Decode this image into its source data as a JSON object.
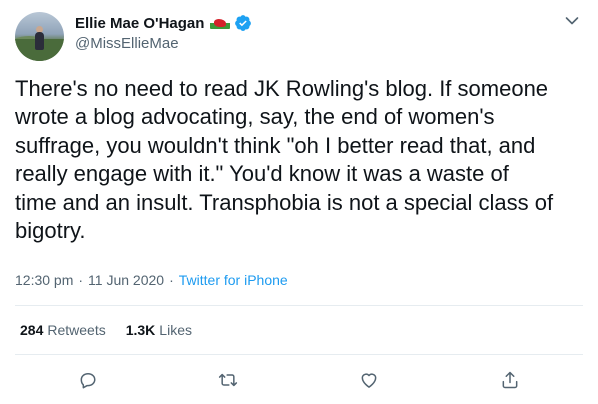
{
  "user": {
    "display_name": "Ellie Mae O'Hagan",
    "handle": "@MissEllieMae",
    "flag_icon": "welsh-flag-icon",
    "verified_icon": "verified-badge-icon",
    "verified_color": "#1da1f2"
  },
  "tweet": {
    "text": "There's no need to read JK Rowling's blog. If someone\nwrote a blog advocating, say, the end of women's\nsuffrage, you wouldn't think \"oh I better read that, and\nreally engage with it.\" You'd know it was a waste of\ntime and an insult. Transphobia is not a special class of\nbigotry.",
    "time": "12:30 pm",
    "separator": "·",
    "date": "11 Jun 2020",
    "source": "Twitter for iPhone"
  },
  "stats": {
    "retweets_count": "284",
    "retweets_label": "Retweets",
    "likes_count": "1.3K",
    "likes_label": "Likes"
  },
  "actions": {
    "reply_icon": "reply-icon",
    "retweet_icon": "retweet-icon",
    "like_icon": "heart-icon",
    "share_icon": "share-icon"
  },
  "colors": {
    "text": "#0f1419",
    "secondary": "#536471",
    "link": "#1d9bf0",
    "divider": "#e6ecf0"
  }
}
